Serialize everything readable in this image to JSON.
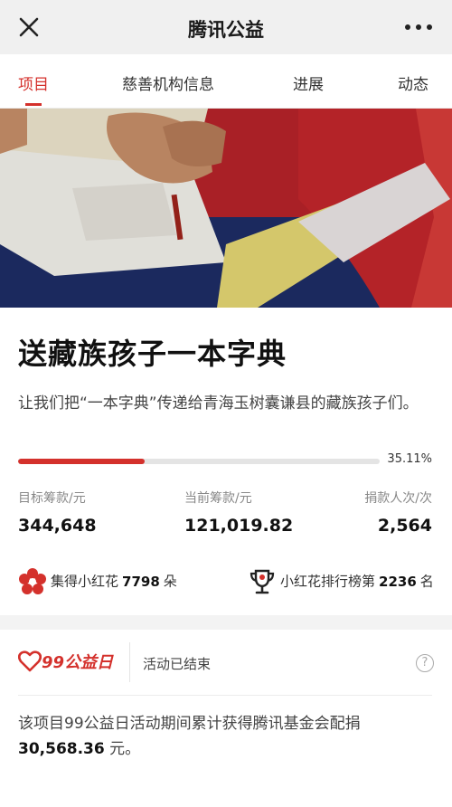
{
  "topbar": {
    "title": "腾讯公益",
    "close_icon": "close-icon",
    "more_icon": "more-icon"
  },
  "tabs": [
    {
      "label": "项目",
      "active": true
    },
    {
      "label": "慈善机构信息",
      "active": false
    },
    {
      "label": "进展",
      "active": false
    },
    {
      "label": "动态",
      "active": false
    }
  ],
  "project": {
    "title": "送藏族孩子一本字典",
    "description": "让我们把“一本字典”传递给青海玉树囊谦县的藏族孩子们。",
    "progress_label": "35.11%",
    "progress_fraction": 0.3511,
    "stats": [
      {
        "label": "目标筹款/元",
        "value": "344,648"
      },
      {
        "label": "当前筹款/元",
        "value": "121,019.82"
      },
      {
        "label": "捐款人次/次",
        "value": "2,564"
      }
    ]
  },
  "flowers": {
    "collected_prefix": "集得小红花",
    "collected_count": "7798",
    "collected_unit": "朵",
    "rank_prefix": "小红花排行榜第",
    "rank_value": "2236",
    "rank_unit": "名"
  },
  "event": {
    "logo_text": "99公益日",
    "status": "活动已结束",
    "help_icon": "help-icon",
    "match_text": "该项目99公益日活动期间累计获得腾讯基金会配捐",
    "match_amount": "30,568.36",
    "match_unit": "元。"
  },
  "colors": {
    "accent": "#d4312c",
    "topbar_bg": "#f0f0f0",
    "track": "#e4e4e4"
  }
}
